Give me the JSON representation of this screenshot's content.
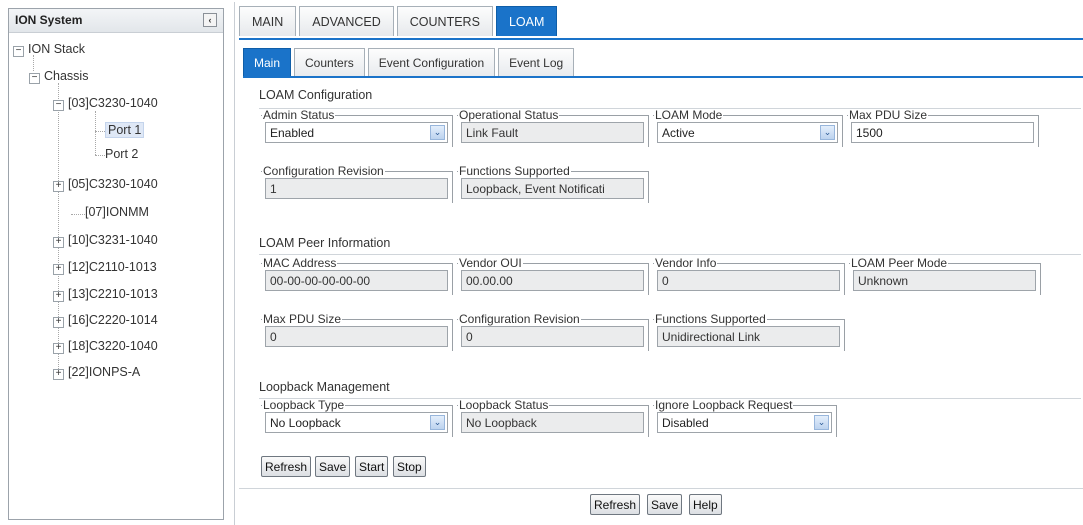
{
  "tree": {
    "title": "ION System",
    "collapse_icon": "chevron-left-icon",
    "collapse_glyph": "‹",
    "nodes": [
      {
        "label": "ION Stack",
        "toggle": "−"
      },
      {
        "label": "Chassis",
        "toggle": "−"
      },
      {
        "label": "[03]C3230-1040",
        "toggle": "−"
      },
      {
        "label": "Port 1",
        "toggle": ""
      },
      {
        "label": "Port 2",
        "toggle": ""
      },
      {
        "label": "[05]C3230-1040",
        "toggle": "+"
      },
      {
        "label": "[07]IONMM",
        "toggle": ""
      },
      {
        "label": "[10]C3231-1040",
        "toggle": "+"
      },
      {
        "label": "[12]C2110-1013",
        "toggle": "+"
      },
      {
        "label": "[13]C2210-1013",
        "toggle": "+"
      },
      {
        "label": "[16]C2220-1014",
        "toggle": "+"
      },
      {
        "label": "[18]C3220-1040",
        "toggle": "+"
      },
      {
        "label": "[22]IONPS-A",
        "toggle": "+"
      }
    ],
    "selected": "Port 1"
  },
  "top_tabs": [
    "MAIN",
    "ADVANCED",
    "COUNTERS",
    "LOAM"
  ],
  "top_tab_active": "LOAM",
  "sub_tabs": [
    "Main",
    "Counters",
    "Event Configuration",
    "Event Log"
  ],
  "sub_tab_active": "Main",
  "loam_config": {
    "title": "LOAM Configuration",
    "admin_status": {
      "label": "Admin Status",
      "value": "Enabled"
    },
    "operational_status": {
      "label": "Operational Status",
      "value": "Link Fault"
    },
    "loam_mode": {
      "label": "LOAM Mode",
      "value": "Active"
    },
    "max_pdu_size": {
      "label": "Max PDU Size",
      "value": "1500"
    },
    "configuration_revision": {
      "label": "Configuration Revision",
      "value": "1"
    },
    "functions_supported": {
      "label": "Functions Supported",
      "value": "Loopback, Event Notificati"
    }
  },
  "peer_info": {
    "title": "LOAM Peer Information",
    "mac_address": {
      "label": "MAC Address",
      "value": "00-00-00-00-00-00"
    },
    "vendor_oui": {
      "label": "Vendor OUI",
      "value": "00.00.00"
    },
    "vendor_info": {
      "label": "Vendor Info",
      "value": "0"
    },
    "peer_mode": {
      "label": "LOAM Peer Mode",
      "value": "Unknown"
    },
    "max_pdu_size": {
      "label": "Max PDU Size",
      "value": "0"
    },
    "configuration_revision": {
      "label": "Configuration Revision",
      "value": "0"
    },
    "functions_supported": {
      "label": "Functions Supported",
      "value": "Unidirectional Link"
    }
  },
  "loopback": {
    "title": "Loopback Management",
    "loopback_type": {
      "label": "Loopback Type",
      "value": "No Loopback"
    },
    "loopback_status": {
      "label": "Loopback Status",
      "value": "No Loopback"
    },
    "ignore_request": {
      "label": "Ignore Loopback Request",
      "value": "Disabled"
    },
    "buttons": {
      "refresh": "Refresh",
      "save": "Save",
      "start": "Start",
      "stop": "Stop"
    }
  },
  "footer_buttons": {
    "refresh": "Refresh",
    "save": "Save",
    "help": "Help"
  },
  "dropdown_glyph": "⌄",
  "colors": {
    "accent": "#1a73c9",
    "readonly_bg": "#ebeced",
    "selected_bg": "#dfe8f6"
  }
}
